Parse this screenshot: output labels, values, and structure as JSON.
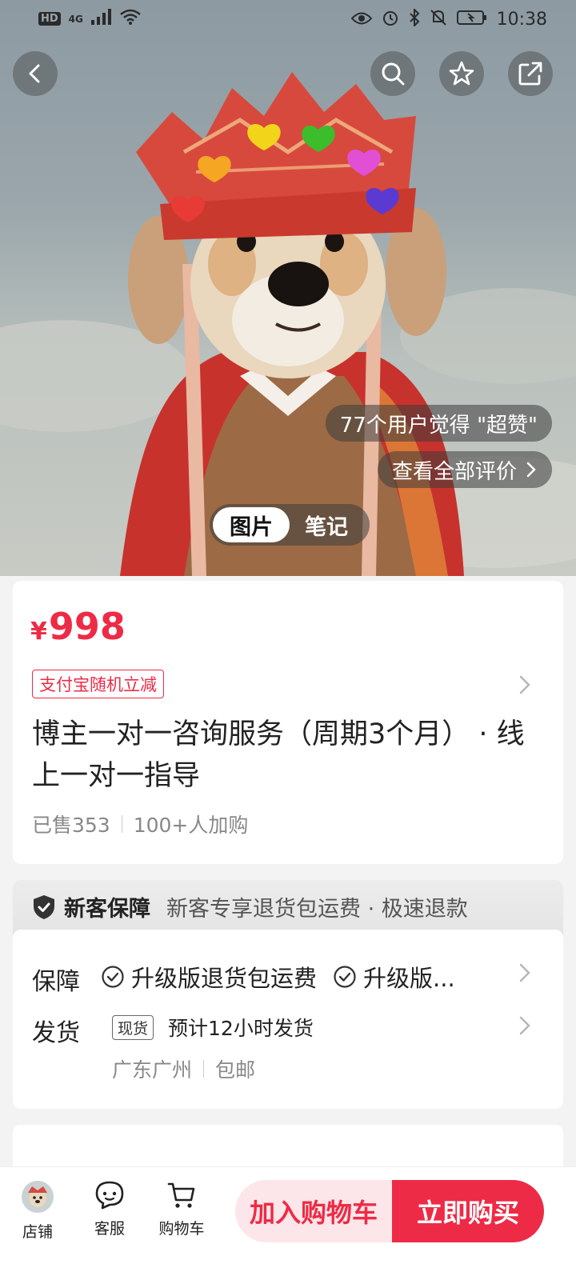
{
  "status_bar": {
    "left_icons": [
      "hd-icon",
      "4g-signal-icon",
      "signal-icon",
      "wifi-icon"
    ],
    "hd_label": "HD",
    "network_label": "4G",
    "right_icons": [
      "eye-icon",
      "alarm-icon",
      "bluetooth-icon",
      "mute-icon",
      "battery-icon"
    ],
    "time": "10:38"
  },
  "hero": {
    "review_count_text": "77个用户觉得 \"超赞\"",
    "view_all_reviews": "查看全部评价",
    "tabs": [
      {
        "label": "图片",
        "active": true
      },
      {
        "label": "笔记",
        "active": false
      }
    ]
  },
  "product": {
    "currency": "¥",
    "price": "998",
    "promo_tag": "支付宝随机立减",
    "title": "博主一对一咨询服务（周期3个月）  ·  线上一对一指导",
    "sold": "已售353",
    "added": "100+人加购"
  },
  "guarantee": {
    "title": "新客保障",
    "desc": "新客专享退货包运费 · 极速退款"
  },
  "services": {
    "guarantee_label": "保障",
    "guarantee_items": [
      "升级版退货包运费",
      "升级版..."
    ],
    "shipping_label": "发货",
    "stock_tag": "现货",
    "shipping_eta": "预计12小时发货",
    "origin": "广东广州",
    "shipping_fee": "包邮"
  },
  "bottom_bar": {
    "store": "店铺",
    "service": "客服",
    "cart": "购物车",
    "add_to_cart": "加入购物车",
    "buy_now": "立即购买"
  },
  "colors": {
    "accent": "#ee2b46",
    "accent_light": "#fde6e9"
  }
}
